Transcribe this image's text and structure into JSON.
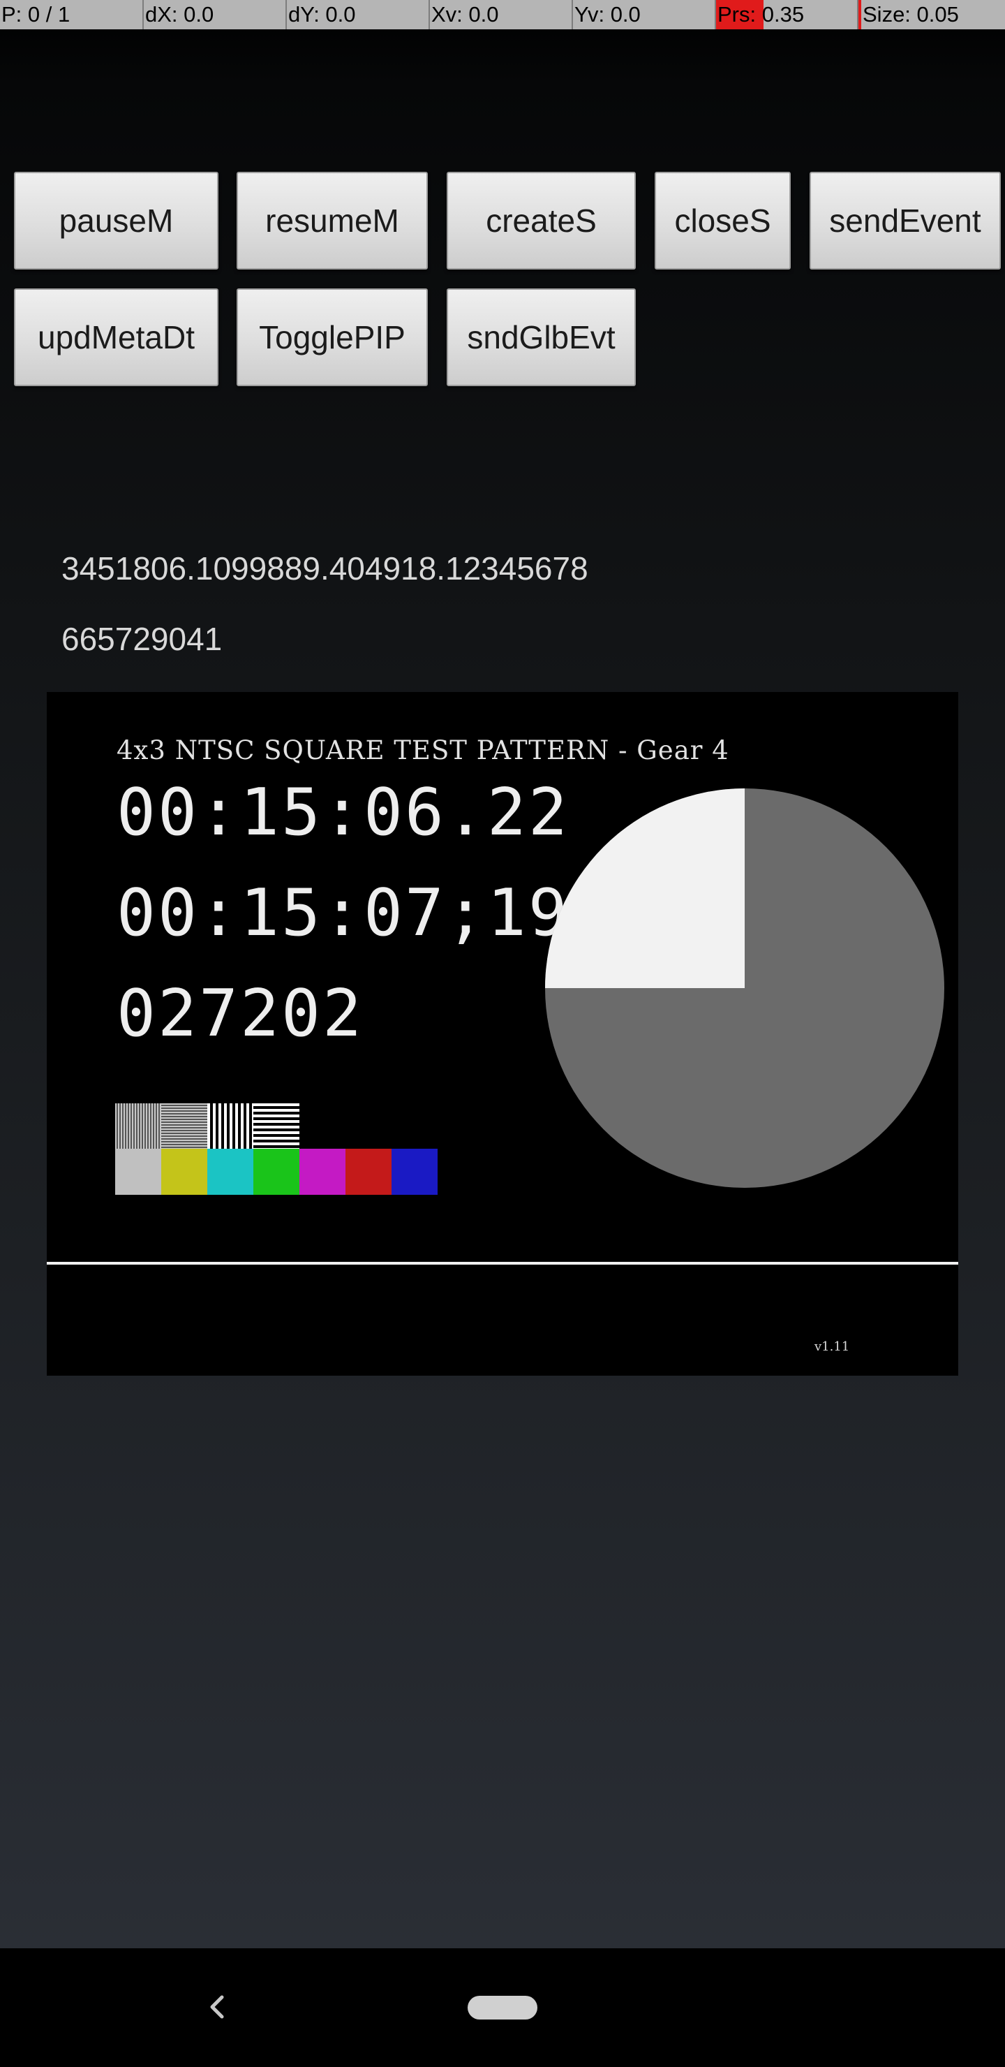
{
  "pointer_location": {
    "pointers": "P: 0 / 1",
    "dx": "dX: 0.0",
    "dy": "dY: 0.0",
    "xv": "Xv: 0.0",
    "yv": "Yv: 0.0",
    "pressure": "Prs: 0.35",
    "size": "Size: 0.05"
  },
  "buttons": {
    "pause": "pauseM",
    "resume": "resumeM",
    "create": "createS",
    "close": "closeS",
    "send_event": "sendEvent",
    "update_metadata": "updMetaDt",
    "toggle_pip": "TogglePIP",
    "send_global_event": "sndGlbEvt"
  },
  "info": {
    "line1": "3451806.1099889.404918.12345678",
    "line2": "665729041"
  },
  "video": {
    "pattern_title": "4x3 NTSC SQUARE TEST PATTERN - Gear 4",
    "timecode_1": "00:15:06.22",
    "timecode_2": "00:15:07;19",
    "frame_count": "027202",
    "version": "v1.11",
    "clock_pie_fraction_highlighted": 0.25,
    "color_bars": [
      "#c0c0c0",
      "#c4c41a",
      "#1bc4c4",
      "#1ac41a",
      "#c41ac4",
      "#c41a1a",
      "#1a1ac4"
    ]
  },
  "navigation": {
    "back_icon": "chevron-left-icon",
    "home_icon": "home-pill-icon"
  }
}
